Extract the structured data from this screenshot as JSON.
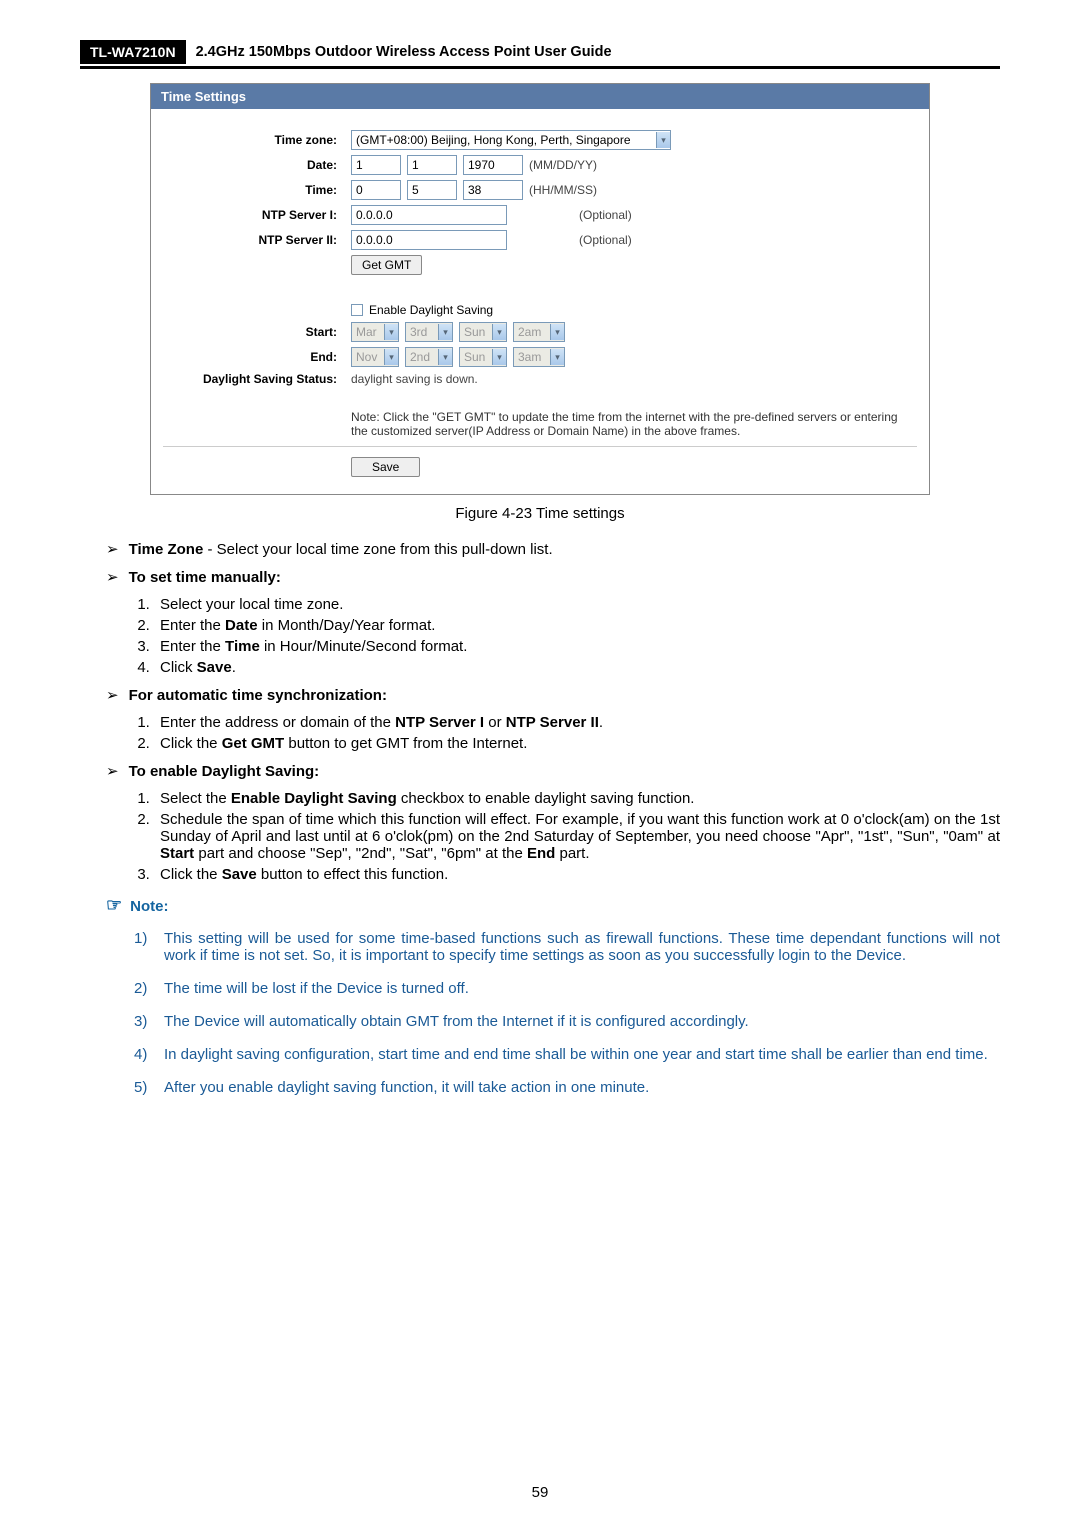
{
  "header": {
    "model": "TL-WA7210N",
    "title": "2.4GHz 150Mbps Outdoor Wireless Access Point User Guide"
  },
  "panel": {
    "title": "Time Settings",
    "labels": {
      "timezone": "Time zone:",
      "date": "Date:",
      "time": "Time:",
      "ntp1": "NTP Server I:",
      "ntp2": "NTP Server II:",
      "start": "Start:",
      "end": "End:",
      "dst_status": "Daylight Saving Status:"
    },
    "values": {
      "timezone": "(GMT+08:00) Beijing, Hong Kong, Perth, Singapore",
      "date_m": "1",
      "date_d": "1",
      "date_y": "1970",
      "date_hint": "(MM/DD/YY)",
      "time_h": "0",
      "time_m": "5",
      "time_s": "38",
      "time_hint": "(HH/MM/SS)",
      "ntp1": "0.0.0.0",
      "ntp2": "0.0.0.0",
      "ntp_hint": "(Optional)",
      "get_gmt": "Get GMT",
      "dst_enable": "Enable Daylight Saving",
      "start_mon": "Mar",
      "start_ord": "3rd",
      "start_day": "Sun",
      "start_hr": "2am",
      "end_mon": "Nov",
      "end_ord": "2nd",
      "end_day": "Sun",
      "end_hr": "3am",
      "dst_status_text": "daylight saving is down.",
      "note": "Note: Click the \"GET GMT\" to update the time from the internet with the pre-defined servers or entering the customized server(IP Address or Domain Name) in the above frames.",
      "save": "Save"
    }
  },
  "caption": "Figure 4-23 Time settings",
  "bullets": {
    "tz_lead": "Time Zone",
    "tz_rest": " - Select your local time zone from this pull-down list.",
    "manual_lead": "To set time manually:",
    "manual_steps": [
      "Select your local time zone.",
      [
        "Enter the ",
        "Date",
        " in Month/Day/Year format."
      ],
      [
        "Enter the ",
        "Time",
        " in Hour/Minute/Second format."
      ],
      [
        "Click ",
        "Save",
        "."
      ]
    ],
    "auto_lead": "For automatic time synchronization:",
    "auto_steps": [
      [
        "Enter the address or domain of the ",
        "NTP Server I",
        " or ",
        "NTP Server II",
        "."
      ],
      [
        "Click the ",
        "Get GMT",
        " button to get GMT from the Internet."
      ]
    ],
    "dst_lead": "To enable Daylight Saving:",
    "dst_steps": [
      [
        "Select the ",
        "Enable Daylight Saving",
        " checkbox to enable daylight saving function."
      ],
      [
        "Schedule the span of time which this function will effect. For example, if you want this function work at 0 o'clock(am) on the 1st Sunday of April and last until at 6 o'clok(pm) on the 2nd Saturday of September, you need choose \"Apr\", \"1st\", \"Sun\", \"0am\" at ",
        "Start",
        " part and choose \"Sep\", \"2nd\", \"Sat\", \"6pm\" at the ",
        "End",
        " part."
      ],
      [
        "Click the ",
        "Save",
        " button to effect this function."
      ]
    ]
  },
  "note_label": "Note:",
  "notes": [
    "This setting will be used for some time-based functions such as firewall functions. These time dependant functions will not work if time is not set. So, it is important to specify time settings as soon as you successfully login to the Device.",
    "The time will be lost if the Device is turned off.",
    "The Device will automatically obtain GMT from the Internet if it is configured accordingly.",
    "In daylight saving configuration, start time and end time shall be within one year and start time shall be earlier than end time.",
    "After you enable daylight saving function, it will take action in one minute."
  ],
  "page_num": "59"
}
